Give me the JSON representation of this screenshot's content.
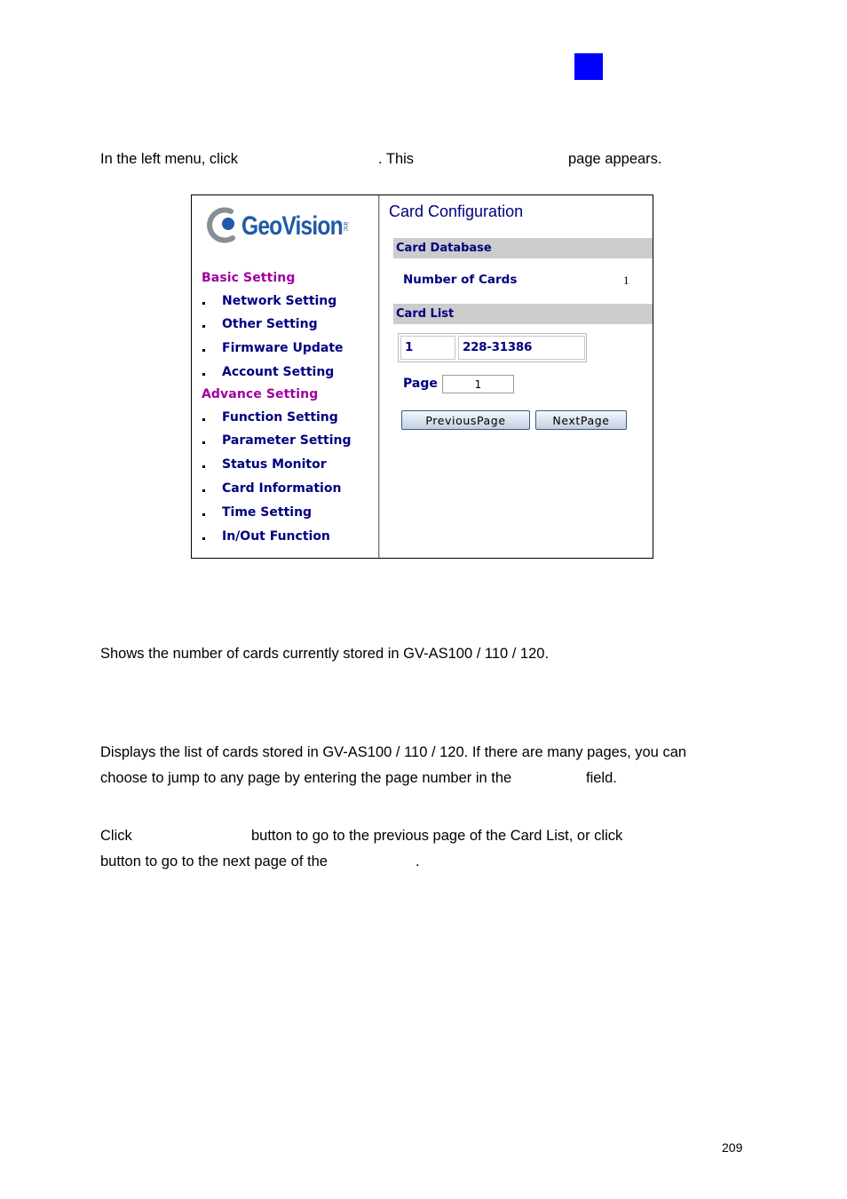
{
  "page": {
    "marker_color": "#0000ff",
    "intro": {
      "part1": "In the left menu, click",
      "part2": ". This",
      "part3": "page appears."
    },
    "number_of_cards_desc": "Shows the number of cards currently stored in GV-AS100 / 110 / 120.",
    "card_list_desc": {
      "line1": "Displays the list of cards stored in GV-AS100 / 110 / 120. If there are many pages, you can",
      "line2a": "choose to jump to any page by entering the page number in the",
      "line2b": "field."
    },
    "buttons_desc": {
      "line1a": "Click",
      "line1b": "button to go to the previous page of the Card List, or click",
      "line2a": "button to go to the next page of the",
      "line2b": "."
    },
    "page_number": "209"
  },
  "screenshot": {
    "logo": {
      "text": "GeoVision",
      "suffix": "inc",
      "brand_color": "#1f5aa6"
    },
    "sidebar": {
      "basic_heading": "Basic Setting",
      "basic_items": [
        {
          "label": "Network Setting"
        },
        {
          "label": "Other Setting"
        },
        {
          "label": "Firmware Update"
        },
        {
          "label": "Account Setting"
        }
      ],
      "advance_heading": "Advance Setting",
      "advance_items": [
        {
          "label": "Function Setting"
        },
        {
          "label": "Parameter Setting"
        },
        {
          "label": "Status Monitor"
        },
        {
          "label": "Card Information"
        },
        {
          "label": "Time Setting"
        },
        {
          "label": "In/Out Function"
        }
      ],
      "heading_color": "#a000a0",
      "item_color": "#000080"
    },
    "content": {
      "title": "Card Configuration",
      "card_database": {
        "heading": "Card Database",
        "number_of_cards_label": "Number of Cards",
        "number_of_cards_value": "1"
      },
      "card_list": {
        "heading": "Card List",
        "rows": [
          {
            "id": "1",
            "card_number": "228-31386"
          }
        ],
        "page_label": "Page",
        "page_value": "1",
        "previous_button": "PreviousPage",
        "next_button": "NextPage"
      }
    }
  }
}
